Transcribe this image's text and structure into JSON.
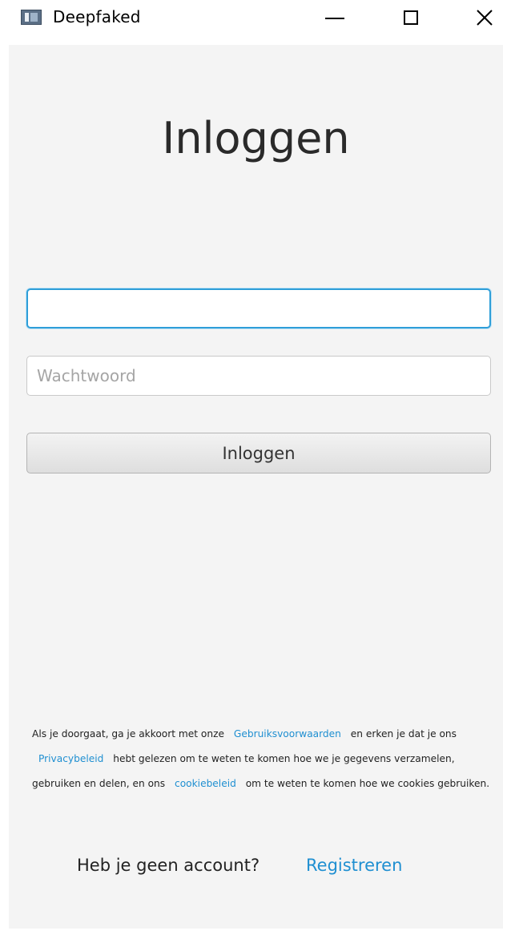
{
  "window": {
    "title": "Deepfaked",
    "icon": "app-window-icon",
    "controls": {
      "minimize": "minimize-icon",
      "maximize": "maximize-icon",
      "close": "close-icon"
    },
    "close_glyph": "✕"
  },
  "login": {
    "heading": "Inloggen",
    "username": {
      "value": "",
      "placeholder": ""
    },
    "password": {
      "value": "",
      "placeholder": "Wachtwoord"
    },
    "submit_label": "Inloggen"
  },
  "legal": {
    "part1": "Als je doorgaat, ga je akkoort met onze",
    "terms_link": "Gebruiksvoorwaarden",
    "part2": "en erken je dat je ons",
    "privacy_link": "Privacybeleid",
    "part3": "hebt gelezen om te weten te komen hoe we je gegevens verzamelen, gebruiken en delen, en ons",
    "cookie_link": "cookiebeleid",
    "part4": "om te weten te komen hoe we cookies gebruiken."
  },
  "signup": {
    "question": "Heb je geen account?",
    "link": "Registreren"
  },
  "colors": {
    "accent": "#2f9ed8",
    "link": "#1f8fd1",
    "background": "#f4f4f4"
  }
}
